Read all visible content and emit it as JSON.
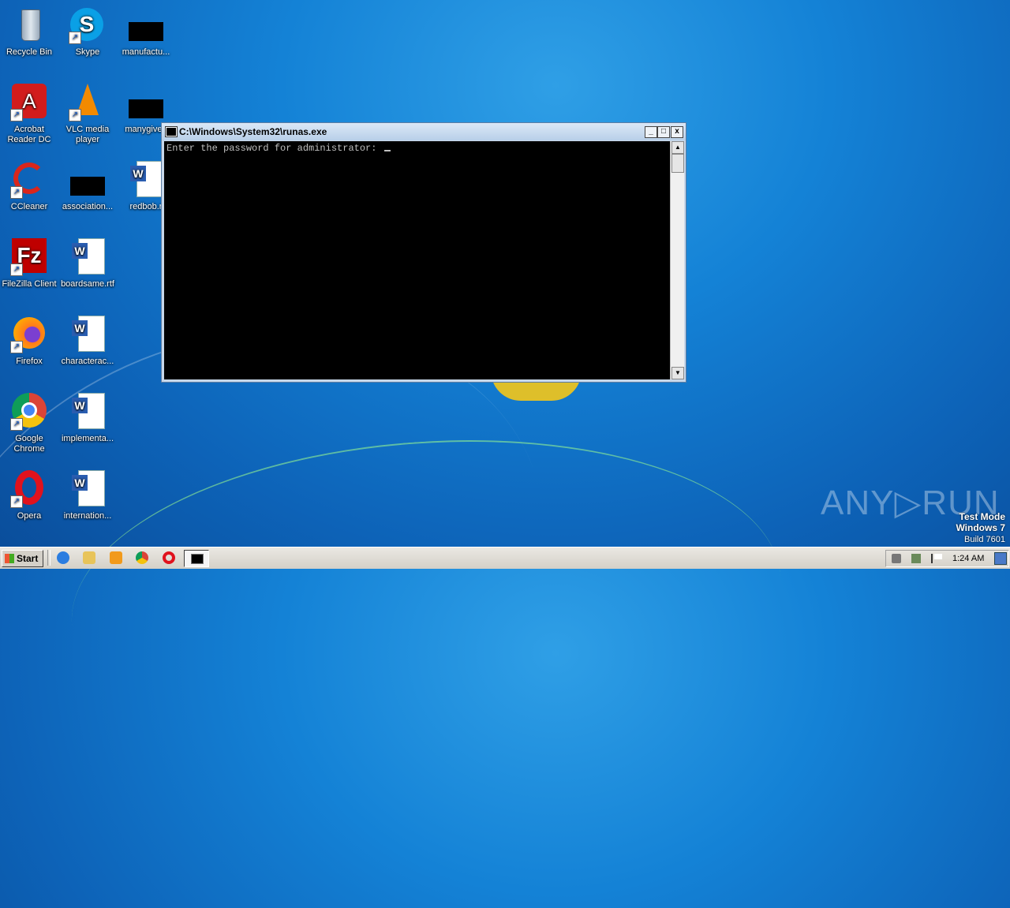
{
  "desktop": {
    "icons": [
      {
        "label": "Recycle Bin",
        "icon": "recycle-bin-icon"
      },
      {
        "label": "Skype",
        "icon": "skype-icon"
      },
      {
        "label": "manufactu...",
        "icon": "redacted-file-icon"
      },
      {
        "label": "Acrobat Reader DC",
        "icon": "acrobat-icon"
      },
      {
        "label": "VLC media player",
        "icon": "vlc-icon"
      },
      {
        "label": "manygiven",
        "icon": "redacted-file-icon"
      },
      {
        "label": "CCleaner",
        "icon": "ccleaner-icon"
      },
      {
        "label": "association...",
        "icon": "redacted-file-icon"
      },
      {
        "label": "redbob.r",
        "icon": "word-doc-icon"
      },
      {
        "label": "FileZilla Client",
        "icon": "filezilla-icon"
      },
      {
        "label": "boardsame.rtf",
        "icon": "word-doc-icon"
      },
      {
        "label": "Firefox",
        "icon": "firefox-icon"
      },
      {
        "label": "characterac...",
        "icon": "word-doc-icon"
      },
      {
        "label": "Google Chrome",
        "icon": "chrome-icon"
      },
      {
        "label": "implementa...",
        "icon": "word-doc-icon"
      },
      {
        "label": "Opera",
        "icon": "opera-icon"
      },
      {
        "label": "internation...",
        "icon": "word-doc-icon"
      }
    ]
  },
  "console": {
    "title": "C:\\Windows\\System32\\runas.exe",
    "line": "Enter the password for administrator: ",
    "minimize": "_",
    "maximize": "□",
    "close": "x"
  },
  "taskbar": {
    "start_label": "Start",
    "clock": "1:24 AM"
  },
  "watermark": {
    "brand": "ANY▷RUN",
    "mode": "Test Mode",
    "os": "Windows 7",
    "build": "Build 7601"
  },
  "colors": {
    "console_bg": "#000000",
    "console_text": "#c0c0c0",
    "desktop_blue": "#1482d6"
  }
}
